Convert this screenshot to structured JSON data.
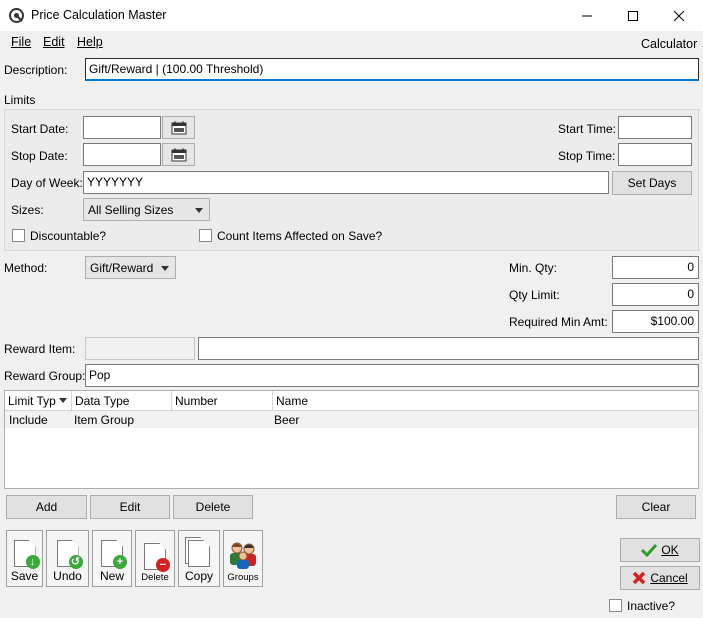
{
  "window": {
    "title": "Price Calculation Master"
  },
  "menu": {
    "file": "File",
    "edit": "Edit",
    "help": "Help",
    "calculator": "Calculator"
  },
  "description": {
    "label": "Description:",
    "value": "Gift/Reward | (100.00 Threshold)"
  },
  "limits": {
    "label": "Limits",
    "start_date_label": "Start Date:",
    "start_date": "",
    "stop_date_label": "Stop Date:",
    "stop_date": "",
    "start_time_label": "Start Time:",
    "start_time": "",
    "stop_time_label": "Stop Time:",
    "stop_time": "",
    "day_of_week_label": "Day of Week:",
    "day_of_week": "YYYYYYY",
    "set_days": "Set Days",
    "sizes_label": "Sizes:",
    "sizes_value": "All Selling Sizes",
    "discountable_label": "Discountable?",
    "count_items_label": "Count Items Affected on Save?"
  },
  "method": {
    "label": "Method:",
    "value": "Gift/Reward"
  },
  "quantities": {
    "min_qty_label": "Min. Qty:",
    "min_qty": "0",
    "qty_limit_label": "Qty Limit:",
    "qty_limit": "0",
    "req_min_amt_label": "Required Min Amt:",
    "req_min_amt": "$100.00"
  },
  "reward": {
    "item_label": "Reward Item:",
    "item_code": "",
    "item_name": "",
    "group_label": "Reward Group:",
    "group_value": "Pop"
  },
  "grid": {
    "columns": [
      "Limit Typ",
      "Data Type",
      "Number",
      "Name"
    ],
    "rows": [
      [
        "Include",
        "Item Group",
        "",
        "Beer"
      ]
    ]
  },
  "grid_buttons": {
    "add": "Add",
    "edit": "Edit",
    "delete": "Delete",
    "clear": "Clear"
  },
  "toolbar": {
    "save": "Save",
    "undo": "Undo",
    "new": "New",
    "delete": "Delete",
    "copy": "Copy",
    "groups": "Groups"
  },
  "dialog": {
    "ok": "OK",
    "cancel": "Cancel",
    "inactive": "Inactive?"
  },
  "colors": {
    "ok_check": "#2e9e2e",
    "cancel_x": "#d42020",
    "badge_green": "#3aa83a",
    "badge_red": "#d42020"
  }
}
